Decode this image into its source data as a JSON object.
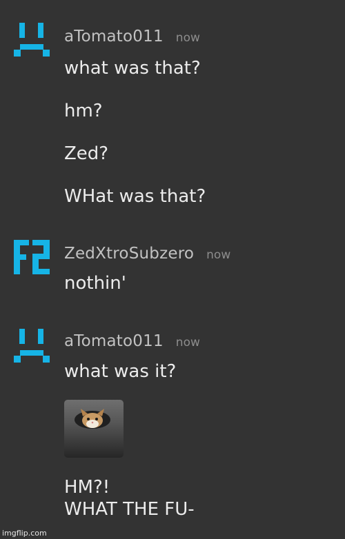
{
  "messages": [
    {
      "avatar_icon": "sad-face-icon",
      "username": "aTomato011",
      "timestamp": "now",
      "lines": [
        "what was that?",
        "hm?",
        "Zed?",
        "WHat was that?"
      ]
    },
    {
      "avatar_icon": "fz-logo-icon",
      "username": "ZedXtroSubzero",
      "timestamp": "now",
      "lines": [
        "nothin'"
      ]
    },
    {
      "avatar_icon": "sad-face-icon",
      "username": "aTomato011",
      "timestamp": "now",
      "lines": [
        "what was it?"
      ],
      "image_icon": "cat-ceiling-image",
      "final_text": "HM?!\nWHAT THE FU-"
    }
  ],
  "watermark": "imgflip.com",
  "colors": {
    "background": "#333333",
    "avatar_accent": "#16b4e6",
    "username": "#c2c2c2",
    "timestamp": "#8d8d8d",
    "message_text": "#ececec"
  }
}
